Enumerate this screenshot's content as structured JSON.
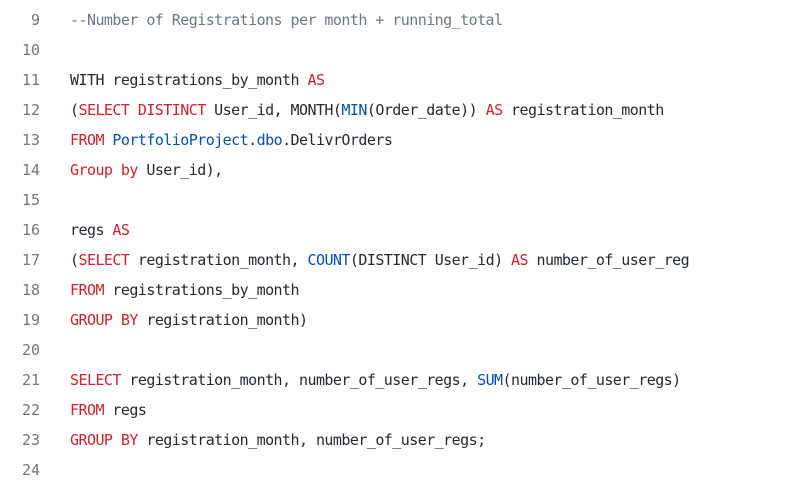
{
  "colors": {
    "background": "#ffffff",
    "keyword": "#cf222e",
    "function": "#0550ae",
    "comment": "#6e7781",
    "identifier": "#24292f",
    "line_number": "#6e7781"
  },
  "lines": [
    {
      "number": "9",
      "tokens": [
        {
          "text": "--Number of Registrations per month + running_total",
          "type": "cm"
        }
      ]
    },
    {
      "number": "10",
      "tokens": []
    },
    {
      "number": "11",
      "tokens": [
        {
          "text": "WITH registrations_by_month ",
          "type": "id"
        },
        {
          "text": "AS",
          "type": "kw"
        }
      ]
    },
    {
      "number": "12",
      "tokens": [
        {
          "text": "(",
          "type": "id"
        },
        {
          "text": "SELECT DISTINCT",
          "type": "kw"
        },
        {
          "text": " User_id, MONTH(",
          "type": "id"
        },
        {
          "text": "MIN",
          "type": "fn"
        },
        {
          "text": "(Order_date)) ",
          "type": "id"
        },
        {
          "text": "AS",
          "type": "kw"
        },
        {
          "text": " registration_month",
          "type": "id"
        }
      ]
    },
    {
      "number": "13",
      "tokens": [
        {
          "text": "FROM",
          "type": "kw"
        },
        {
          "text": " ",
          "type": "id"
        },
        {
          "text": "PortfolioProject",
          "type": "fn"
        },
        {
          "text": ".",
          "type": "id"
        },
        {
          "text": "dbo",
          "type": "fn"
        },
        {
          "text": ".DelivrOrders",
          "type": "id"
        }
      ]
    },
    {
      "number": "14",
      "tokens": [
        {
          "text": "Group by",
          "type": "kw"
        },
        {
          "text": " User_id),",
          "type": "id"
        }
      ]
    },
    {
      "number": "15",
      "tokens": []
    },
    {
      "number": "16",
      "tokens": [
        {
          "text": "regs ",
          "type": "id"
        },
        {
          "text": "AS",
          "type": "kw"
        }
      ]
    },
    {
      "number": "17",
      "tokens": [
        {
          "text": "(",
          "type": "id"
        },
        {
          "text": "SELECT",
          "type": "kw"
        },
        {
          "text": " registration_month, ",
          "type": "id"
        },
        {
          "text": "COUNT",
          "type": "fn"
        },
        {
          "text": "(DISTINCT User_id) ",
          "type": "id"
        },
        {
          "text": "AS",
          "type": "kw"
        },
        {
          "text": " number_of_user_reg",
          "type": "id"
        }
      ]
    },
    {
      "number": "18",
      "tokens": [
        {
          "text": "FROM",
          "type": "kw"
        },
        {
          "text": " registrations_by_month",
          "type": "id"
        }
      ]
    },
    {
      "number": "19",
      "tokens": [
        {
          "text": "GROUP BY",
          "type": "kw"
        },
        {
          "text": " registration_month)",
          "type": "id"
        }
      ]
    },
    {
      "number": "20",
      "tokens": []
    },
    {
      "number": "21",
      "tokens": [
        {
          "text": "SELECT",
          "type": "kw"
        },
        {
          "text": " registration_month, number_of_user_regs, ",
          "type": "id"
        },
        {
          "text": "SUM",
          "type": "fn"
        },
        {
          "text": "(number_of_user_regs)",
          "type": "id"
        }
      ]
    },
    {
      "number": "22",
      "tokens": [
        {
          "text": "FROM",
          "type": "kw"
        },
        {
          "text": " regs",
          "type": "id"
        }
      ]
    },
    {
      "number": "23",
      "tokens": [
        {
          "text": "GROUP BY",
          "type": "kw"
        },
        {
          "text": " registration_month, number_of_user_regs;",
          "type": "id"
        }
      ]
    },
    {
      "number": "24",
      "tokens": []
    }
  ]
}
